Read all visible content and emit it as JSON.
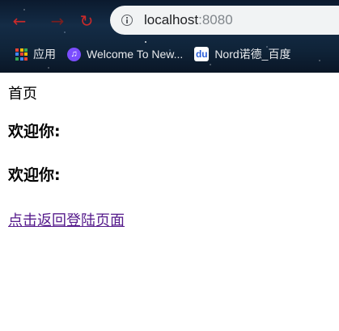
{
  "browser": {
    "url_host": "localhost",
    "url_port": ":8080",
    "back_icon": "arrow-left-icon",
    "forward_icon": "arrow-right-icon",
    "reload_icon": "reload-icon",
    "nav_color": "#c92a2a",
    "bookmarks": [
      {
        "label": "应用",
        "icon": "apps-grid-icon"
      },
      {
        "label": "Welcome To New...",
        "icon": "music-note-icon",
        "icon_color": "#7b4dff"
      },
      {
        "label": "Nord诺德_百度",
        "icon": "baidu-paw-icon",
        "icon_color": "#2b5fd9"
      }
    ]
  },
  "page": {
    "home_text": "首页",
    "welcome_1": "欢迎你:",
    "welcome_2": "欢迎你:",
    "back_link": "点击返回登陆页面",
    "link_color": "#551a8b"
  }
}
